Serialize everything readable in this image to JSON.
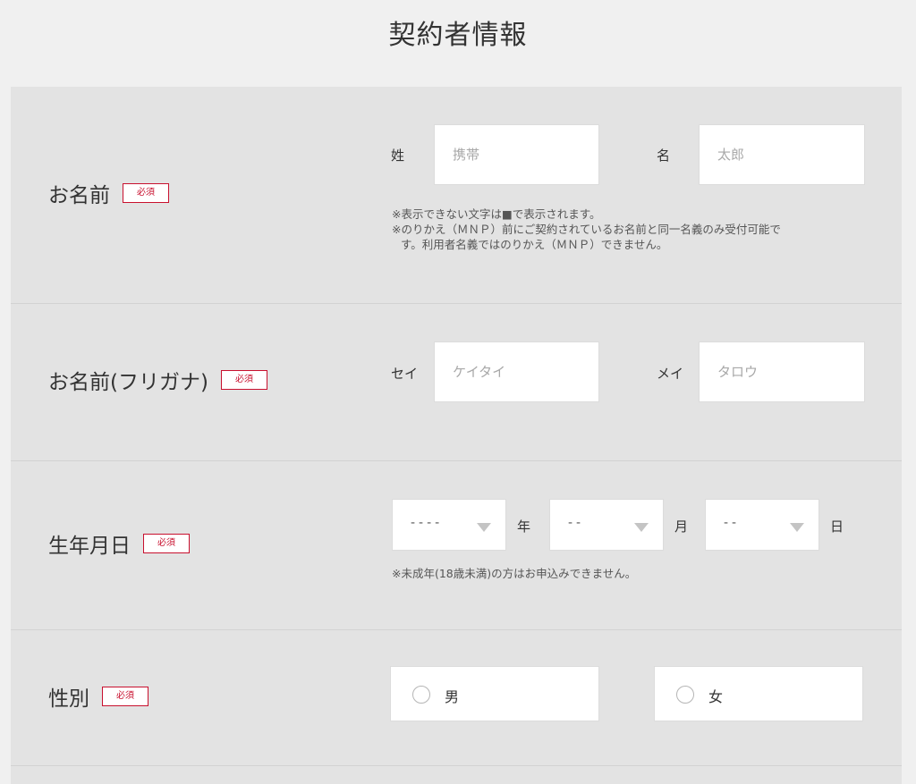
{
  "page": {
    "title": "契約者情報"
  },
  "required_label": "必須",
  "name": {
    "label": "お名前",
    "last_label": "姓",
    "last_placeholder": "携帯",
    "first_label": "名",
    "first_placeholder": "太郎",
    "note1": "※表示できない文字は■で表示されます。",
    "note2": "※のりかえ（ＭＮＰ）前にご契約されているお名前と同一名義のみ受付可能で",
    "note3": "す。利用者名義ではのりかえ（ＭＮＰ）できません。"
  },
  "kana": {
    "label": "お名前(フリガナ)",
    "last_label": "セイ",
    "last_placeholder": "ケイタイ",
    "first_label": "メイ",
    "first_placeholder": "タロウ"
  },
  "birthdate": {
    "label": "生年月日",
    "year_value": "----",
    "year_unit": "年",
    "month_value": "--",
    "month_unit": "月",
    "day_value": "--",
    "day_unit": "日",
    "note": "※未成年(18歳未満)の方はお申込みできません。"
  },
  "gender": {
    "label": "性別",
    "male": "男",
    "female": "女"
  }
}
